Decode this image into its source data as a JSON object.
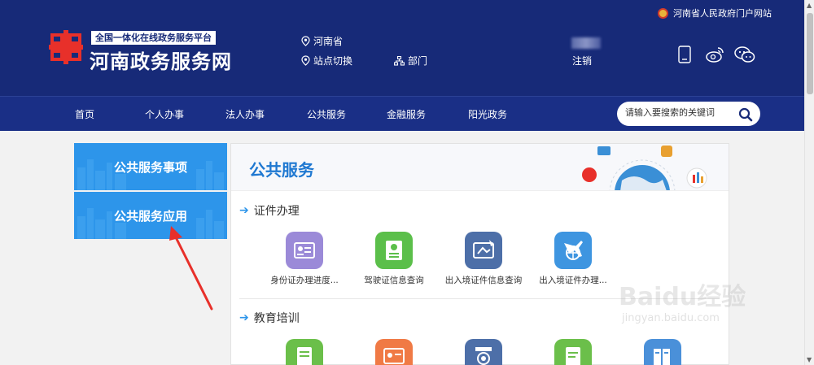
{
  "header": {
    "top_link": "河南省人民政府门户网站",
    "logo_sub": "全国一体化在线政务服务平台",
    "logo_title": "河南政务服务网",
    "location": "河南省",
    "switch_site": "站点切换",
    "department": "部门",
    "logout": "注销"
  },
  "nav": {
    "items": [
      "首页",
      "个人办事",
      "法人办事",
      "公共服务",
      "金融服务",
      "阳光政务"
    ],
    "search_placeholder": "请输入要搜索的关键词"
  },
  "sidebar": {
    "tabs": [
      "公共服务事项",
      "公共服务应用"
    ]
  },
  "panel": {
    "title": "公共服务",
    "sections": [
      {
        "title": "证件办理",
        "items": [
          {
            "label": "身份证办理进度...",
            "icon": "id-card-icon",
            "color": "#9b8ad8"
          },
          {
            "label": "驾驶证信息查询",
            "icon": "driver-license-icon",
            "color": "#5bbf4a"
          },
          {
            "label": "出入境证件信息查询",
            "icon": "passport-certificate-icon",
            "color": "#4d6fa8"
          },
          {
            "label": "出入境证件办理...",
            "icon": "airplane-globe-icon",
            "color": "#3e95e0"
          }
        ]
      },
      {
        "title": "教育培训",
        "items": [
          {
            "label": "",
            "icon": "document-check-icon",
            "color": "#6bbf4a"
          },
          {
            "label": "",
            "icon": "certificate-icon",
            "color": "#f07a45"
          },
          {
            "label": "",
            "icon": "award-icon",
            "color": "#4d6fa8"
          },
          {
            "label": "",
            "icon": "notebook-icon",
            "color": "#6bbf4a"
          },
          {
            "label": "",
            "icon": "books-icon",
            "color": "#4a90d9"
          }
        ]
      }
    ]
  },
  "watermark": {
    "brand": "Baidu经验",
    "url": "jingyan.baidu.com"
  },
  "colors": {
    "header_bg": "#172a78",
    "nav_bg": "#1a2f86",
    "tab_bg": "#2d95ea",
    "accent": "#1f78d1",
    "annotation_arrow": "#e8302a"
  }
}
